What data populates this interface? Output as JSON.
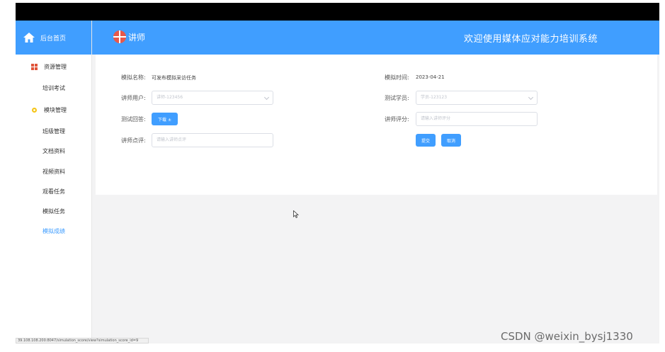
{
  "sidebar": {
    "home_label": "后台首页",
    "groups": [
      {
        "label": "资源管理",
        "items": [
          "培训考试"
        ]
      },
      {
        "label": "模块管理",
        "items": [
          "班级管理",
          "文档资料",
          "视频资料",
          "观看任务",
          "模拟任务",
          "模拟成绩"
        ]
      }
    ],
    "active_item": "模拟成绩"
  },
  "header": {
    "brand": "讲师",
    "welcome": "欢迎使用媒体应对能力培训系统"
  },
  "form": {
    "name_label": "模拟名称:",
    "name_value": "可发布模拟采访任务",
    "time_label": "模拟时间:",
    "time_value": "2023-04-21",
    "teacher_user_label": "讲师用户:",
    "teacher_user_value": "讲师-123456",
    "student_label": "测试学员:",
    "student_value": "学员-123123",
    "answer_label": "测试回答:",
    "download_button": "下载 ±",
    "score_label": "讲师评分:",
    "score_placeholder": "请输入讲师评分",
    "comment_label": "讲师点评:",
    "comment_placeholder": "请输入讲师点评",
    "submit_button": "提交",
    "cancel_button": "取消"
  },
  "statusbar": {
    "url": "39.108.108.200:8047/simulation_score/view?simulation_score_id=9"
  },
  "watermark": "CSDN @weixin_bysj1330",
  "colors": {
    "primary": "#409eff",
    "resource_icon": "#e0543a",
    "module_icon": "#f5c518",
    "active_text": "#409eff"
  }
}
